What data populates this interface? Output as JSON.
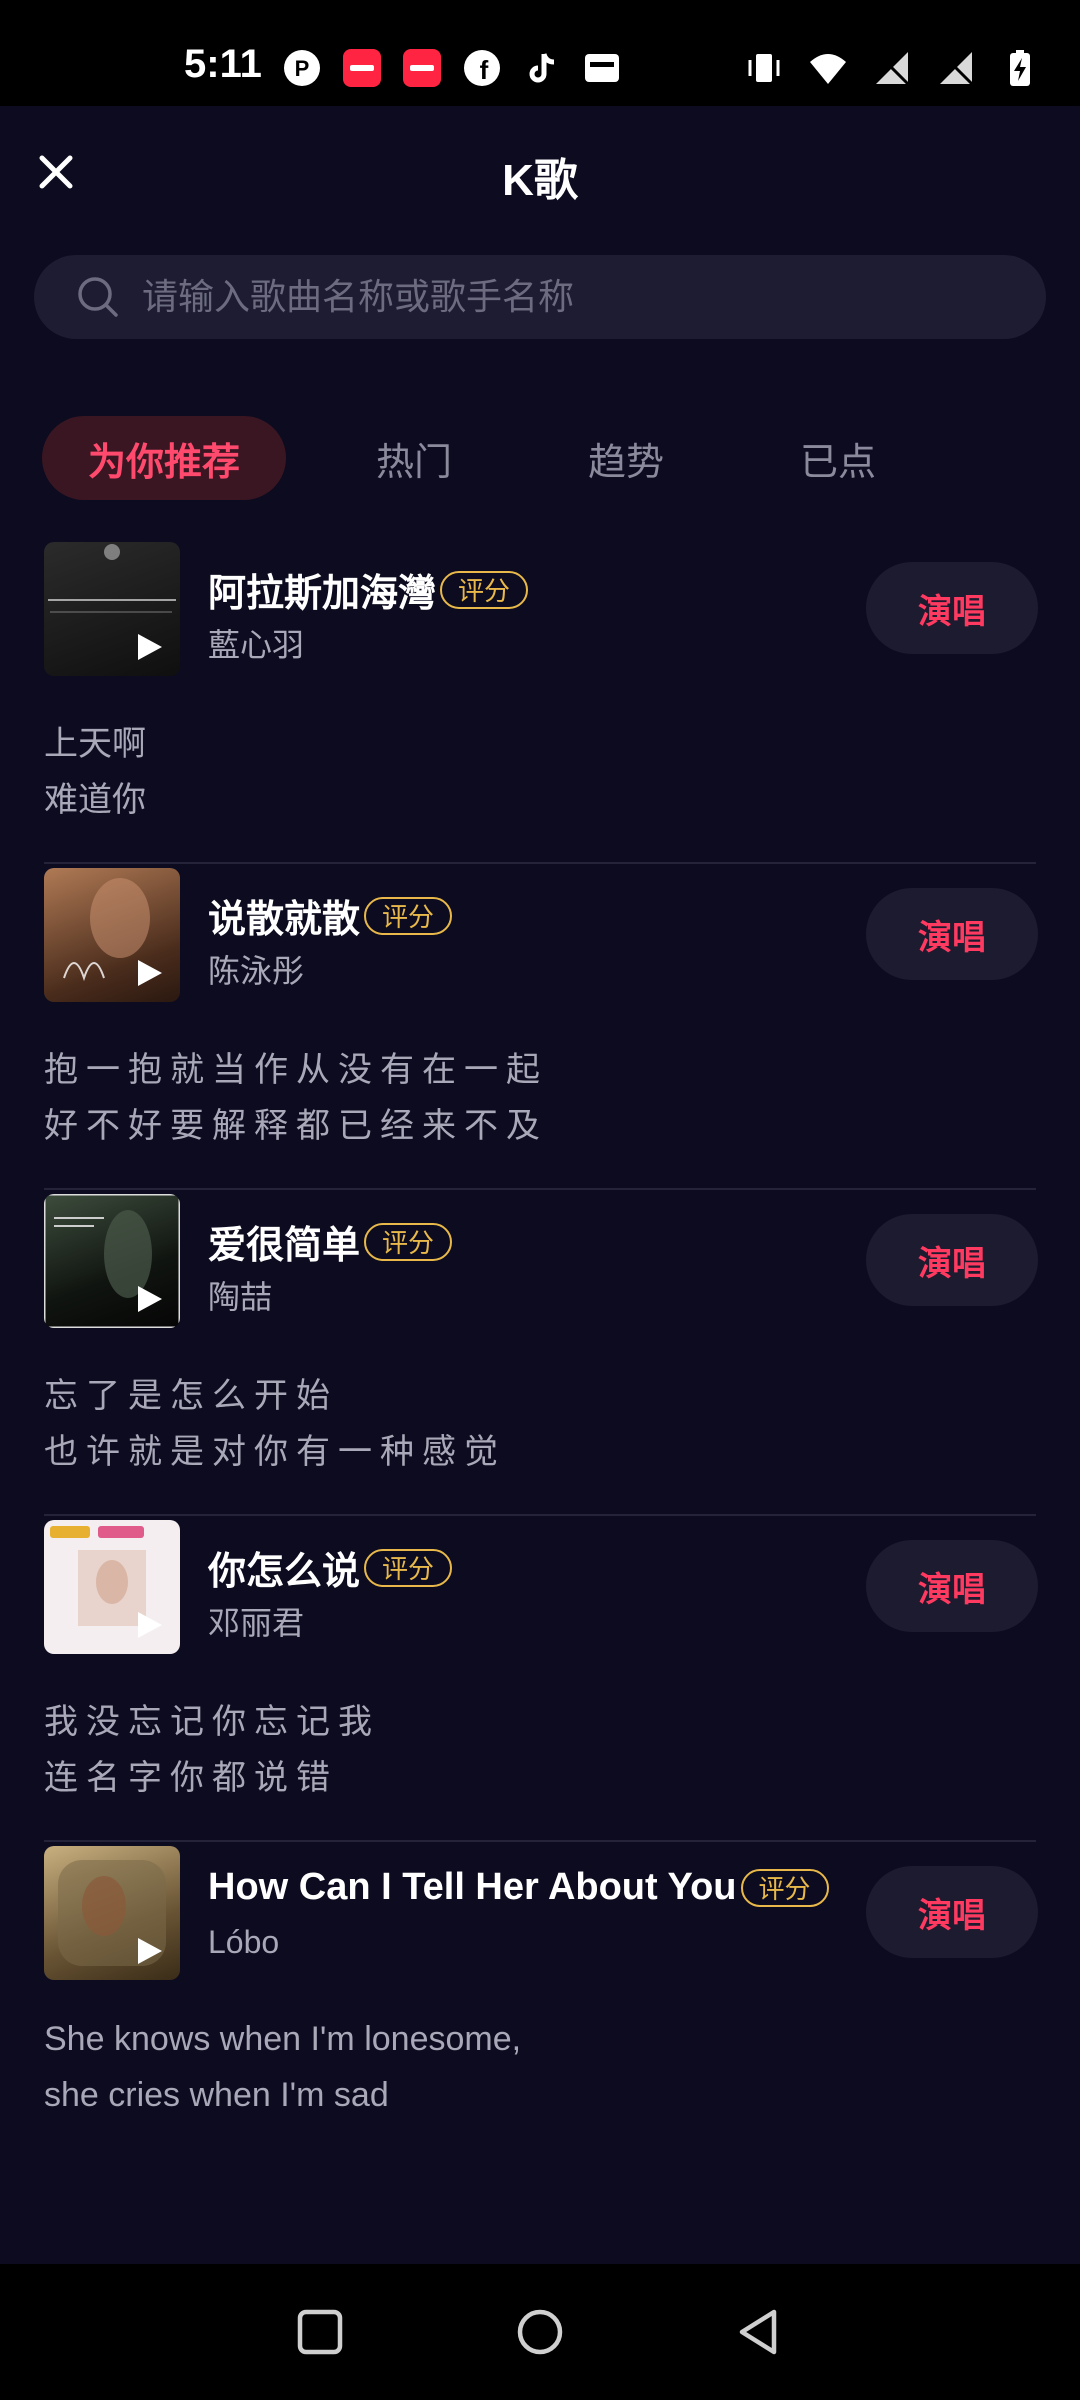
{
  "status": {
    "time": "5:11",
    "left_icons": [
      "p-app-icon",
      "xiaohongshu-icon",
      "xiaohongshu-icon",
      "facebook-icon",
      "tiktok-icon",
      "wallet-icon"
    ],
    "right_icons": [
      "vibrate-icon",
      "wifi-icon",
      "signal-icon",
      "signal-icon",
      "battery-charging-icon"
    ]
  },
  "header": {
    "title": "K歌"
  },
  "search": {
    "placeholder": "请输入歌曲名称或歌手名称"
  },
  "tabs": [
    {
      "label": "为你推荐",
      "active": true
    },
    {
      "label": "热门",
      "active": false
    },
    {
      "label": "趋势",
      "active": false
    },
    {
      "label": "已点",
      "active": false
    }
  ],
  "songs": [
    {
      "title": "阿拉斯加海灣",
      "badge": "评分",
      "artist": "藍心羽",
      "button": "演唱",
      "lyrics": [
        "上天啊",
        "难道你"
      ],
      "cover_colors": [
        "#2a2a2a",
        "#0f0f0f"
      ]
    },
    {
      "title": "说散就散",
      "badge": "评分",
      "artist": "陈泳彤",
      "button": "演唱",
      "lyrics": [
        "抱一抱就当作从没有在一起",
        "好不好要解释都已经来不及"
      ],
      "cover_colors": [
        "#9a6a4a",
        "#3a2418"
      ]
    },
    {
      "title": "爱很简单",
      "badge": "评分",
      "artist": "陶喆",
      "button": "演唱",
      "lyrics": [
        "忘了是怎么开始",
        "也许就是对你有一种感觉"
      ],
      "cover_colors": [
        "#3a4a3a",
        "#0a0a0a"
      ]
    },
    {
      "title": "你怎么说",
      "badge": "评分",
      "artist": "邓丽君",
      "button": "演唱",
      "lyrics": [
        "我没忘记你忘记我",
        "连名字你都说错"
      ],
      "cover_colors": [
        "#f2e6ea",
        "#e8d0c8"
      ]
    },
    {
      "title": "How Can I Tell Her About You",
      "badge": "评分",
      "artist": "Lóbo",
      "button": "演唱",
      "lyrics": [
        "She knows when I'm lonesome,",
        "she cries when I'm sad"
      ],
      "cover_colors": [
        "#b8a070",
        "#5a4a30"
      ]
    }
  ],
  "colors": {
    "background": "#0c0b1f",
    "accent": "#ff3a60",
    "badge": "#e8b94a"
  }
}
